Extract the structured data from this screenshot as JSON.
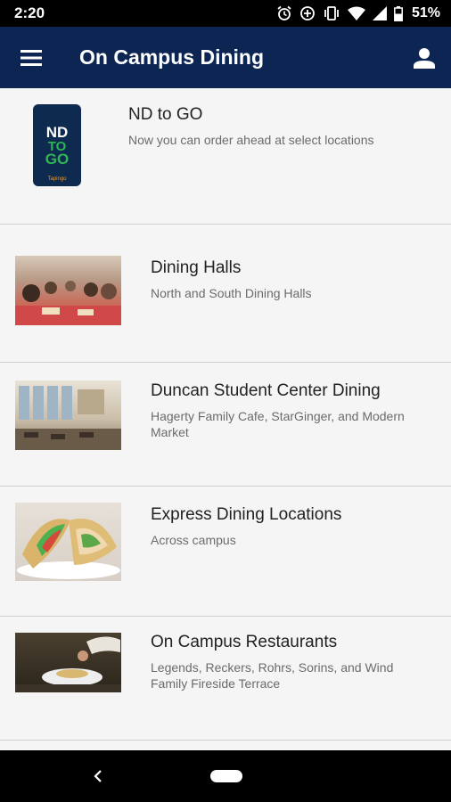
{
  "status": {
    "time": "2:20",
    "battery": "51%"
  },
  "header": {
    "title": "On Campus Dining",
    "menu_icon": "menu-icon",
    "profile_icon": "person-icon"
  },
  "nd_to_go": {
    "title": "ND to GO",
    "subtitle": "Now you can order ahead at select locations",
    "logo_lines": [
      "ND",
      "TO",
      "GO"
    ],
    "logo_footer": "Tapingo"
  },
  "items": [
    {
      "title": "Dining Halls",
      "subtitle": "North and South Dining Halls"
    },
    {
      "title": "Duncan Student Center Dining",
      "subtitle": "Hagerty Family Cafe, StarGinger, and Modern Market"
    },
    {
      "title": "Express Dining Locations",
      "subtitle": "Across campus"
    },
    {
      "title": "On Campus Restaurants",
      "subtitle": "Legends, Reckers, Rohrs, Sorins, and Wind Family Fireside Terrace"
    }
  ],
  "colors": {
    "app_bar": "#0c2552",
    "logo_green": "#2fb457",
    "logo_orange": "#f29a1d"
  }
}
